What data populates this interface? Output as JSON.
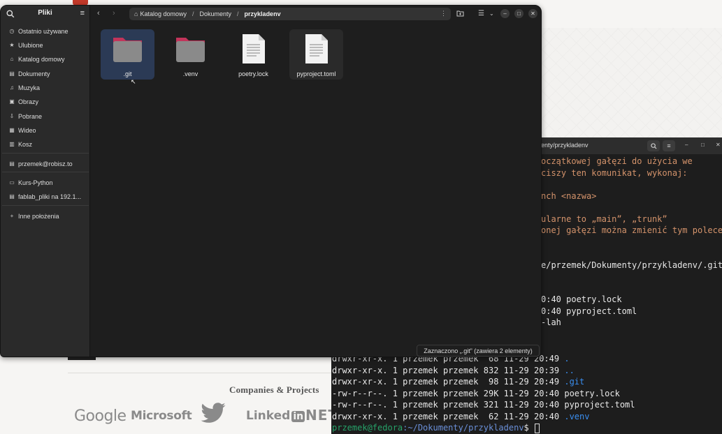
{
  "web_page": {
    "companies_heading": "Companies & Projects",
    "logos": {
      "google": "Google",
      "microsoft": "Microsoft",
      "twitter": "twitter-bird-icon",
      "linkedin_text": "Linked",
      "linkedin_in": "in",
      "netflix": "NETF"
    }
  },
  "file_manager": {
    "app_title": "Pliki",
    "sidebar": {
      "items": [
        {
          "icon": "clock-icon",
          "label": "Ostatnio używane"
        },
        {
          "icon": "star-icon",
          "label": "Ulubione"
        },
        {
          "icon": "home-icon",
          "label": "Katalog domowy"
        },
        {
          "icon": "document-icon",
          "label": "Dokumenty"
        },
        {
          "icon": "music-icon",
          "label": "Muzyka"
        },
        {
          "icon": "picture-icon",
          "label": "Obrazy"
        },
        {
          "icon": "download-icon",
          "label": "Pobrane"
        },
        {
          "icon": "video-icon",
          "label": "Wideo"
        },
        {
          "icon": "trash-icon",
          "label": "Kosz"
        }
      ],
      "network": {
        "label": "przemek@robisz.to"
      },
      "bookmarks": [
        {
          "label": "Kurs-Python"
        },
        {
          "label": "fablab_pliki na 192.1..."
        }
      ],
      "other_locations": "Inne położenia"
    },
    "path": {
      "segments": [
        "Katalog domowy",
        "Dokumenty"
      ],
      "current": "przykladenv",
      "separator": "/"
    },
    "files": [
      {
        "name": ".git",
        "type": "folder",
        "selected": true
      },
      {
        "name": ".venv",
        "type": "folder",
        "selected": false
      },
      {
        "name": "poetry.lock",
        "type": "document",
        "selected": false
      },
      {
        "name": "pyproject.toml",
        "type": "document",
        "selected": false
      }
    ],
    "status": "Zaznaczono „.git” (zawiera 2 elementy)",
    "colors": {
      "selection": "#2b3a55",
      "folder": "#8a8a8a",
      "folder_tab": "#c2345a"
    }
  },
  "terminal": {
    "title": "enty/przykladenv",
    "upper_lines": [
      {
        "text": "oczątkowej gałęzi do użycia we",
        "style": "warn"
      },
      {
        "text": "ciszy ten komunikat, wykonaj:",
        "style": "warn"
      },
      {
        "text": "",
        "style": "warn"
      },
      {
        "text": "nch <nazwa>",
        "style": "warn"
      },
      {
        "text": "",
        "style": "warn"
      },
      {
        "text": "ularne to „main”, „trunk”",
        "style": "warn"
      },
      {
        "text": "onej gałęzi można zmienić tym polecen",
        "style": "warn"
      },
      {
        "text": "",
        "style": "plain"
      },
      {
        "text": "",
        "style": "plain"
      },
      {
        "text": "e/przemek/Dokumenty/przykladenv/.git/",
        "style": "plain"
      },
      {
        "text": "",
        "style": "plain"
      },
      {
        "text": "",
        "style": "plain"
      },
      {
        "text": "0:40 poetry.lock",
        "style": "plain"
      },
      {
        "text": "0:40 pyproject.toml",
        "style": "plain"
      },
      {
        "text": "-lah",
        "style": "plain"
      }
    ],
    "listing": [
      {
        "meta": "drwxr-xr-x. 1 przemek przemek  68 11-29 20:49 ",
        "name": ".",
        "dir": true
      },
      {
        "meta": "drwxr-xr-x. 1 przemek przemek 832 11-29 20:39 ",
        "name": "..",
        "dir": true
      },
      {
        "meta": "drwxr-xr-x. 1 przemek przemek  98 11-29 20:49 ",
        "name": ".git",
        "dir": true
      },
      {
        "meta": "-rw-r--r--. 1 przemek przemek 29K 11-29 20:40 ",
        "name": "poetry.lock",
        "dir": false
      },
      {
        "meta": "-rw-r--r--. 1 przemek przemek 321 11-29 20:40 ",
        "name": "pyproject.toml",
        "dir": false
      },
      {
        "meta": "drwxr-xr-x. 1 przemek przemek  62 11-29 20:40 ",
        "name": ".venv",
        "dir": true
      }
    ],
    "prompt": {
      "user_host": "przemek@fedora",
      "path": ":~/Dokumenty/przykladenv",
      "symbol": "$ "
    }
  }
}
